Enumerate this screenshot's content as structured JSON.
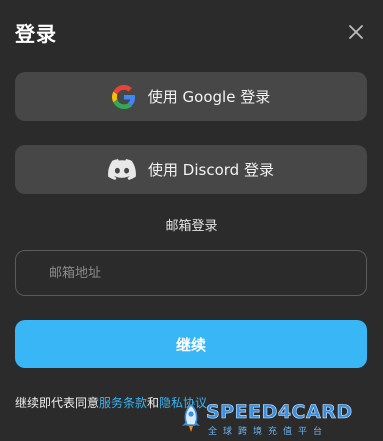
{
  "dialog": {
    "title": "登录",
    "google_button": "使用 Google 登录",
    "discord_button": "使用 Discord 登录",
    "email_heading": "邮箱登录",
    "email_placeholder": "邮箱地址",
    "continue_button": "继续",
    "terms": {
      "prefix": "继续即代表同意",
      "terms_link": "服务条款",
      "and": "和",
      "privacy_link": "隐私协议"
    }
  },
  "watermark": {
    "brand": "SPEED4CARD",
    "tagline": "全球跨境充值平台"
  },
  "colors": {
    "background": "#2b2b2b",
    "button_bg": "#474747",
    "accent": "#38b6f6",
    "link": "#39b4f2"
  },
  "icons": [
    "close-icon",
    "google-icon",
    "discord-icon",
    "rocket-icon"
  ]
}
